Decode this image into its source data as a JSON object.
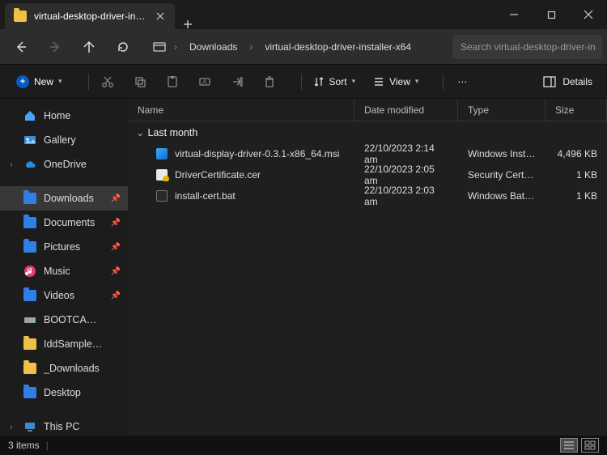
{
  "window": {
    "tab_title": "virtual-desktop-driver-installer"
  },
  "address": {
    "crumbs": [
      "Downloads",
      "virtual-desktop-driver-installer-x64"
    ],
    "search_placeholder": "Search virtual-desktop-driver-in"
  },
  "toolbar": {
    "new_label": "New",
    "sort_label": "Sort",
    "view_label": "View",
    "details_label": "Details"
  },
  "columns": {
    "name": "Name",
    "date": "Date modified",
    "type": "Type",
    "size": "Size"
  },
  "group": {
    "label": "Last month"
  },
  "files": [
    {
      "name": "virtual-display-driver-0.3.1-x86_64.msi",
      "date": "22/10/2023 2:14 am",
      "type": "Windows Installer ...",
      "size": "4,496 KB",
      "icon": "msi"
    },
    {
      "name": "DriverCertificate.cer",
      "date": "22/10/2023 2:05 am",
      "type": "Security Certificate",
      "size": "1 KB",
      "icon": "cer"
    },
    {
      "name": "install-cert.bat",
      "date": "22/10/2023 2:03 am",
      "type": "Windows Batch File",
      "size": "1 KB",
      "icon": "bat"
    }
  ],
  "sidebar": {
    "top": [
      {
        "label": "Home",
        "icon": "home"
      },
      {
        "label": "Gallery",
        "icon": "gallery"
      },
      {
        "label": "OneDrive",
        "icon": "onedrive",
        "expander": true
      }
    ],
    "main": [
      {
        "label": "Downloads",
        "icon": "folder-blue",
        "pinned": true,
        "active": true
      },
      {
        "label": "Documents",
        "icon": "folder-blue",
        "pinned": true
      },
      {
        "label": "Pictures",
        "icon": "folder-blue",
        "pinned": true
      },
      {
        "label": "Music",
        "icon": "music",
        "pinned": true
      },
      {
        "label": "Videos",
        "icon": "folder-blue",
        "pinned": true
      },
      {
        "label": "BOOTCAMP (C:)",
        "icon": "drive"
      },
      {
        "label": "IddSampleDriver",
        "icon": "folder-yellow"
      },
      {
        "label": "_Downloads",
        "icon": "folder-yellow"
      },
      {
        "label": "Desktop",
        "icon": "folder-blue"
      }
    ],
    "bottom": [
      {
        "label": "This PC",
        "icon": "thispc",
        "expander": true
      }
    ]
  },
  "status": {
    "count": "3 items"
  }
}
